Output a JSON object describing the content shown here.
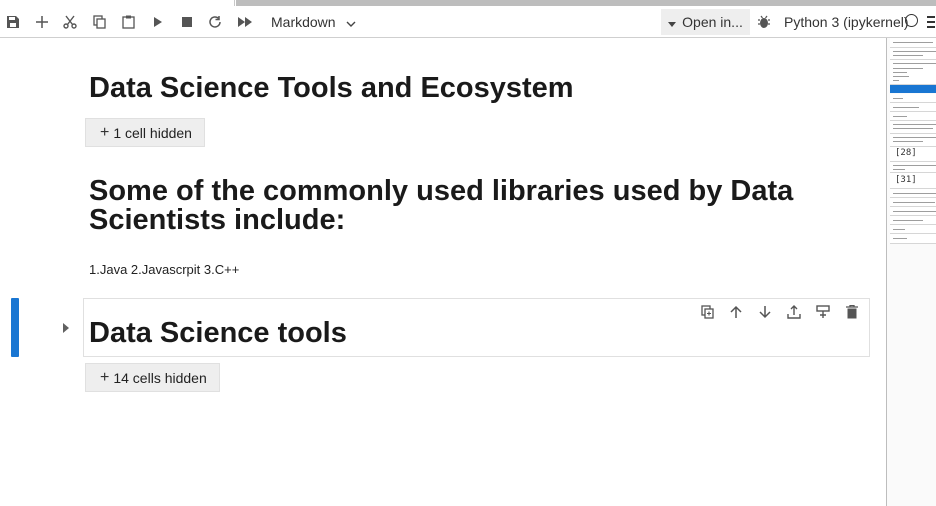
{
  "toolbar": {
    "cell_type": "Markdown",
    "open_in": "Open in...",
    "kernel": "Python 3 (ipykernel)"
  },
  "notebook": {
    "title_heading": "Data Science Tools and Ecosystem",
    "hidden_1": "1 cell hidden",
    "libraries_heading": "Some of the commonly used libraries used by Data Scientists include:",
    "languages_text": "1.Java 2.Javascrpit 3.C++",
    "tools_heading": "Data Science tools",
    "hidden_2": "14 cells hidden"
  },
  "minimap": {
    "cell_numbers": [
      "[28]",
      "[31]"
    ]
  },
  "icons": [
    "save-icon",
    "add-cell-icon",
    "cut-icon",
    "copy-icon",
    "paste-icon",
    "run-icon",
    "stop-icon",
    "restart-icon",
    "run-all-icon",
    "debug-icon",
    "duplicate-icon",
    "move-up-icon",
    "move-down-icon",
    "insert-above-icon",
    "insert-below-icon",
    "delete-icon"
  ],
  "colors": {
    "accent": "#1976d2",
    "toolbar_bg": "#ffffff",
    "hidden_btn_bg": "#eeeeee"
  }
}
